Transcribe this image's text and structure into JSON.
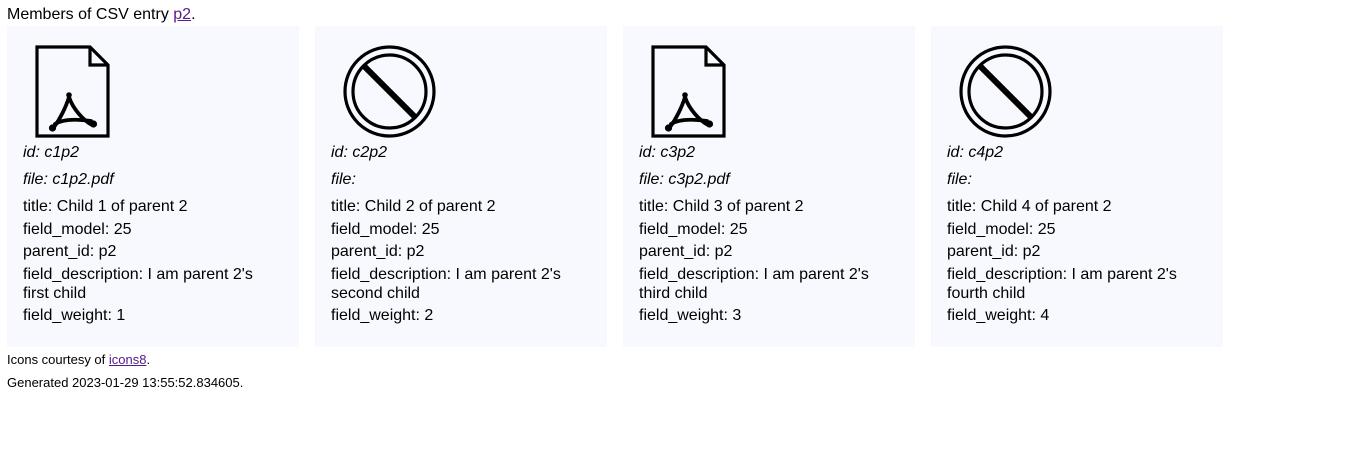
{
  "header": {
    "prefix": "Members of CSV entry ",
    "entry_link": "p2",
    "suffix": "."
  },
  "cards": [
    {
      "icon": "pdf-file-icon",
      "id_label": "id: c1p2",
      "file_label": "file: c1p2.pdf",
      "title": "title: Child 1 of parent 2",
      "field_model": "field_model: 25",
      "parent_id": "parent_id: p2",
      "field_description": "field_description: I am parent 2's first child",
      "field_weight": "field_weight: 1"
    },
    {
      "icon": "no-file-icon",
      "id_label": "id: c2p2",
      "file_label": "file:",
      "title": "title: Child 2 of parent 2",
      "field_model": "field_model: 25",
      "parent_id": "parent_id: p2",
      "field_description": "field_description: I am parent 2's second child",
      "field_weight": "field_weight: 2"
    },
    {
      "icon": "pdf-file-icon",
      "id_label": "id: c3p2",
      "file_label": "file: c3p2.pdf",
      "title": "title: Child 3 of parent 2",
      "field_model": "field_model: 25",
      "parent_id": "parent_id: p2",
      "field_description": "field_description: I am parent 2's third child",
      "field_weight": "field_weight: 3"
    },
    {
      "icon": "no-file-icon",
      "id_label": "id: c4p2",
      "file_label": "file:",
      "title": "title: Child 4 of parent 2",
      "field_model": "field_model: 25",
      "parent_id": "parent_id: p2",
      "field_description": "field_description: I am parent 2's fourth child",
      "field_weight": "field_weight: 4"
    }
  ],
  "footer": {
    "credits_prefix": "Icons courtesy of ",
    "credits_link": "icons8",
    "credits_suffix": ".",
    "generated": "Generated 2023-01-29 13:55:52.834605."
  },
  "colors": {
    "card_background": "#f8f9fe",
    "link": "#551a8b"
  }
}
